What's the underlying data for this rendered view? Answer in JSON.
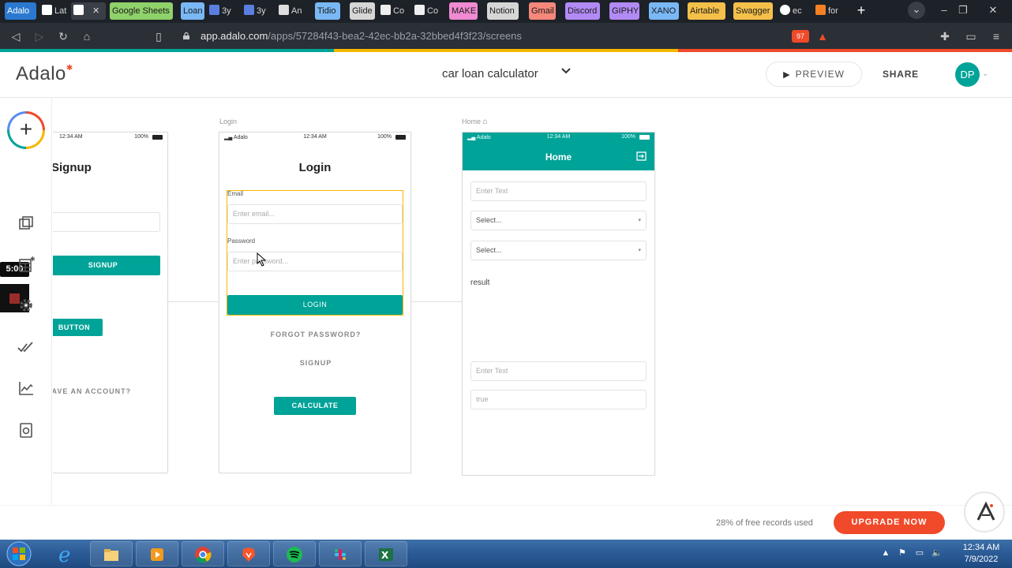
{
  "browser": {
    "tabs": [
      {
        "label": "Adalo",
        "color": "#2b78d0"
      },
      {
        "label": "Lat",
        "color": "#1d2128"
      },
      {
        "label": "",
        "color": "#3a3f47",
        "active": true
      },
      {
        "label": "Google Sheets",
        "color": "#8fd16a"
      },
      {
        "label": "Loan",
        "color": "#7ab8f5"
      },
      {
        "label": "3y",
        "color": "#1d2128"
      },
      {
        "label": "3y",
        "color": "#1d2128"
      },
      {
        "label": "An",
        "color": "#1d2128"
      },
      {
        "label": "Tidio",
        "color": "#7ab8f5"
      },
      {
        "label": "Glide",
        "color": "#d6d6d6"
      },
      {
        "label": "Co",
        "color": "#1d2128"
      },
      {
        "label": "Co",
        "color": "#1d2128"
      },
      {
        "label": "MAKE",
        "color": "#f08ad2"
      },
      {
        "label": "Notion",
        "color": "#d6d6d6"
      },
      {
        "label": "Gmail",
        "color": "#f5887a"
      },
      {
        "label": "Discord",
        "color": "#b28af5"
      },
      {
        "label": "GIPHY",
        "color": "#b28af5"
      },
      {
        "label": "XANO",
        "color": "#7ab8f5"
      },
      {
        "label": "Airtable",
        "color": "#f5c04a"
      },
      {
        "label": "Swagger",
        "color": "#f5c04a"
      },
      {
        "label": "ec",
        "color": "#1d2128"
      },
      {
        "label": "for",
        "color": "#1d2128"
      }
    ],
    "url_host": "app.adalo.com",
    "url_path": "/apps/57284f43-bea2-42ec-bb2a-32bbed4f3f23/screens",
    "brave_count": "97"
  },
  "header": {
    "logo": "Adalo",
    "project_name": "car loan calculator",
    "preview_label": "PREVIEW",
    "share_label": "SHARE",
    "avatar_initials": "DP"
  },
  "toolbar": {
    "timer": "5:00"
  },
  "screens": {
    "signup": {
      "time": "12:34 AM",
      "battery": "100%",
      "title": "Signup",
      "signup_btn": "SIGNUP",
      "button_btn": "BUTTON",
      "have_account": "HAVE AN ACCOUNT?"
    },
    "login": {
      "label": "Login",
      "carrier": "Adalo",
      "time": "12:34 AM",
      "battery": "100%",
      "title": "Login",
      "email_label": "Email",
      "email_placeholder": "Enter email...",
      "password_label": "Password",
      "password_placeholder": "Enter password...",
      "login_btn": "LOGIN",
      "forgot": "FORGOT PASSWORD?",
      "signup_link": "SIGNUP",
      "calculate_btn": "CALCULATE"
    },
    "home": {
      "label": "Home",
      "carrier": "Adalo",
      "time": "12:34 AM",
      "battery": "100%",
      "title": "Home",
      "text_input_1": "Enter Text",
      "select_1": "Select...",
      "select_2": "Select...",
      "result_text": "result",
      "text_input_2": "Enter Text",
      "text_input_3": "true"
    }
  },
  "footer": {
    "records_text": "28% of free records used",
    "upgrade_label": "UPGRADE NOW"
  },
  "taskbar": {
    "time": "12:34 AM",
    "date": "7/9/2022"
  },
  "colors": {
    "teal": "#00a398",
    "orange": "#f04a2a",
    "yellow": "#f5b800"
  }
}
